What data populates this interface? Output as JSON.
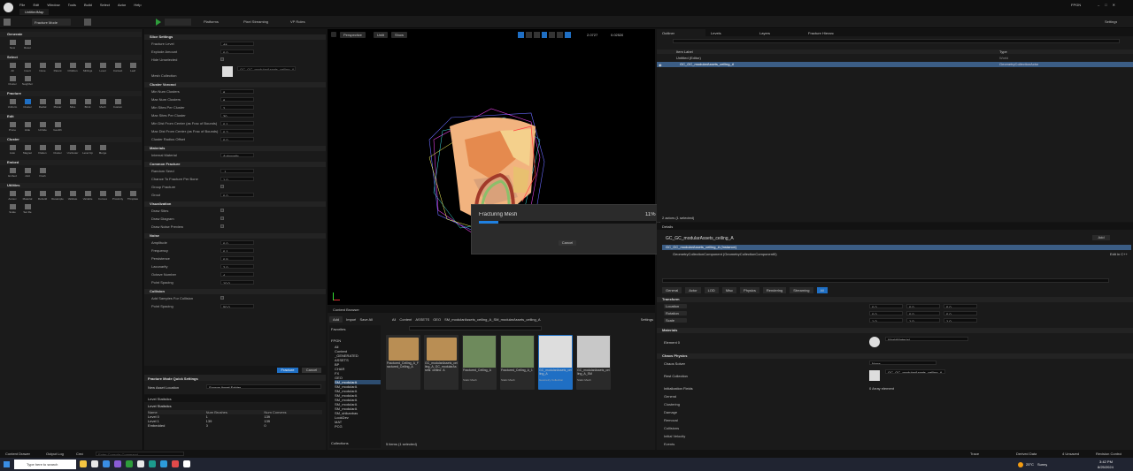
{
  "menu": [
    "File",
    "Edit",
    "Window",
    "Tools",
    "Build",
    "Select",
    "Actor",
    "Help"
  ],
  "project": "UntitledMap",
  "title_right": "FPGN",
  "mode": "Fracture Mode",
  "toolbar": {
    "platforms": "Platforms",
    "pixel": "Pixel Streaming",
    "vp": "VP Roles",
    "settings": "Settings"
  },
  "left_sections": [
    {
      "name": "Generate",
      "items": [
        "New",
        "Reset"
      ]
    },
    {
      "name": "Select",
      "items": [
        "All",
        "Invert",
        "None",
        "Parent",
        "Children",
        "Siblings",
        "Level",
        "Contact",
        "Leaf",
        "Cluster",
        "Neighbor"
      ]
    },
    {
      "name": "Fracture",
      "items": [
        "Uniform",
        "Cluster",
        "Radial",
        "Planar",
        "Slice",
        "Brick",
        "Mesh",
        "Custom"
      ]
    },
    {
      "name": "Edit",
      "items": [
        "Prune",
        "Hide",
        "Unhide",
        "Geolith"
      ]
    },
    {
      "name": "Cluster",
      "items": [
        "Auto",
        "Magnet",
        "Flatten",
        "Cluster",
        "Uncluster",
        "Level Up",
        "Merge"
      ]
    },
    {
      "name": "Embed",
      "items": [
        "Embed",
        "Add",
        "Flush"
      ]
    },
    {
      "name": "Utilities",
      "items": [
        "Autouv",
        "Material",
        "Rebuild",
        "Resample",
        "Validate",
        "Variable",
        "Convex",
        "Proximity",
        "Thinplate",
        "Scale",
        "Set Re"
      ]
    }
  ],
  "props": [
    {
      "section": "Slice Settings",
      "rows": [
        [
          "Fracture Level",
          "All"
        ],
        [
          "Explode Amount",
          "0.0"
        ],
        [
          "Hide Unselected",
          ""
        ],
        [
          "",
          ""
        ],
        [
          "Mesh Collection",
          "GC_GC_modularAssets_ceiling_A"
        ]
      ]
    },
    {
      "section": "Cluster Voronoi",
      "rows": [
        [
          "Min Num Clusters",
          "8"
        ],
        [
          "Max Num Clusters",
          "8"
        ],
        [
          "Min Sites Per Cluster",
          "2"
        ],
        [
          "Max Sites Per Cluster",
          "30"
        ],
        [
          "Min Dist From Center (as Frac of Bounds)",
          "0.1"
        ],
        [
          "Max Dist From Center (as Frac of Bounds)",
          "0.2"
        ],
        [
          "Cluster Radius Offset",
          "0.0"
        ]
      ]
    },
    {
      "section": "Materials",
      "rows": [
        [
          "Internal Material",
          "Automatic"
        ]
      ]
    },
    {
      "section": "Common Fracture",
      "rows": [
        [
          "Random Seed",
          "-1"
        ],
        [
          "Chance To Fracture Per Bone",
          "1.0"
        ],
        [
          "Group Fracture",
          ""
        ],
        [
          "Grout",
          "0.0"
        ]
      ]
    },
    {
      "section": "Visualization",
      "rows": [
        [
          "Draw Sites",
          ""
        ],
        [
          "Draw Diagram",
          ""
        ],
        [
          "Draw Noise Preview",
          ""
        ]
      ]
    },
    {
      "section": "Noise",
      "rows": [
        [
          "Amplitude",
          "0.0"
        ],
        [
          "Frequency",
          "0.1"
        ],
        [
          "Persistence",
          "0.5"
        ],
        [
          "Lacunarity",
          "2.0"
        ],
        [
          "Octave Number",
          "4"
        ],
        [
          "Point Spacing",
          "10.0"
        ]
      ]
    },
    {
      "section": "Collision",
      "rows": [
        [
          "Add Samples For Collision",
          ""
        ],
        [
          "Point Spacing",
          "50.0"
        ]
      ]
    }
  ],
  "fracture_btn": "Fracture",
  "cancel_btn": "Cancel",
  "quick": {
    "title": "Fracture Mode Quick Settings",
    "label": "New Asset Location",
    "value": "Source Asset Folder"
  },
  "levelstats": {
    "tab": "Level Statistics",
    "sub": "Level Statistics",
    "cols": [
      "Name",
      "Num Brushes",
      "Num Convexs"
    ],
    "rows": [
      [
        "Level 0",
        "1",
        "139"
      ],
      [
        "Level 1",
        "139",
        "139"
      ],
      [
        "Embedded",
        "0",
        "0"
      ]
    ]
  },
  "viewport": {
    "perspective": "Perspective",
    "lit": "Unlit",
    "show": "Show",
    "speed": "2.0727",
    "fov": "0.02526"
  },
  "progress": {
    "title": "Fracturing Mesh",
    "pct": "11%",
    "value": 0.11,
    "cancel": "Cancel"
  },
  "content": {
    "tab": "Content Browser",
    "add": "Add",
    "import": "Import",
    "saveall": "Save All",
    "path": [
      "All",
      "Content",
      "ASSETS",
      "GEO",
      "SM_modularAssets_ceiling_A_SM_modularAssets_ceiling_A"
    ],
    "settings": "Settings",
    "favorites": "Favorites",
    "root": "FPGN",
    "tree": [
      "All",
      "Content",
      "_GENERATED",
      "ASSETS",
      "BP",
      "CHAR",
      "FX",
      "GEO",
      "SM_modularA",
      "SM_modularA",
      "SM_modularA",
      "SM_modularA",
      "SM_modularA",
      "SM_modularA",
      "SM_modularA",
      "SM_shikanbas",
      "LookDev",
      "MAT",
      "PCG"
    ],
    "collections": "Collections",
    "count": "5 items (1 selected)",
    "assets": [
      {
        "name": "Fractured_Ceiling_A_Fractured_Ceiling_A",
        "type": "",
        "kind": "folder"
      },
      {
        "name": "GC_modularAssets_ceiling_A_GC_modularAssets_ceiling_A",
        "type": "",
        "kind": "folder"
      },
      {
        "name": "Fractured_Ceiling_A",
        "type": "Static Mesh",
        "kind": "mesh"
      },
      {
        "name": "Fractured_Ceiling_A_1",
        "type": "Static Mesh",
        "kind": "mesh"
      },
      {
        "name": "GC_modularAssets_ceiling_A",
        "type": "Geometry Collection",
        "kind": "sel"
      },
      {
        "name": "GC_modularAssets_ceiling_A_SM",
        "type": "Static Mesh",
        "kind": "mesh2"
      }
    ]
  },
  "outliner": {
    "tabs": [
      "Outliner",
      "Levels",
      "Layers",
      "Fracture Hierarc"
    ],
    "col1": "Item Label",
    "col2": "Type",
    "rows": [
      [
        "Untitled (Editor)",
        "World"
      ],
      [
        "GC_GC_modularAssets_ceiling_A",
        "GeometryCollectionActor"
      ]
    ],
    "actors": "2 actors (1 selected)"
  },
  "details": {
    "tab": "Details",
    "actor": "GC_GC_modularAssets_ceiling_A",
    "add": "Add",
    "instance": "GC_GC_modularAssets_ceiling_A (Instance)",
    "component": "GeometryCollectionComponent (GeometryCollectionComponent0)",
    "editin": "Edit in C++",
    "filters": [
      "General",
      "Actor",
      "LOD",
      "Misc",
      "Physics",
      "Rendering",
      "Streaming",
      "All"
    ],
    "transform": "Transform",
    "location": "Location",
    "rotation": "Rotation",
    "scale": "Scale",
    "loc": [
      "0.0",
      "0.0",
      "0.0"
    ],
    "rot": [
      "0.0",
      "0.0",
      "0.0"
    ],
    "scl": [
      "1.0",
      "1.0",
      "1.0"
    ],
    "materials": "Materials",
    "element": "Element 0",
    "wm": "WorldMaterial",
    "chaos": "Chaos Physics",
    "solver": "Chaos Solver",
    "none": "None",
    "restcol": "Rest Collection",
    "restval": "GC_GC_modularAssets_ceiling_A",
    "initvel": "Initialization Fields",
    "elements": "0 Array element",
    "cats": [
      "General",
      "Clustering",
      "Damage",
      "Removal",
      "Collisions",
      "Initial Velocity",
      "Events"
    ]
  },
  "status": {
    "drawer": "Content Drawer",
    "output": "Output Log",
    "cmd": "Cmd",
    "cmdph": "Enter Console Command",
    "derived": "Derived Data",
    "unsaved": "4 Unsaved",
    "revision": "Revision Control",
    "trace": "Trace"
  },
  "taskbar": {
    "search": "Type here to search",
    "weather": "25°C",
    "cond": "Sunny",
    "time": "3:42 PM",
    "date": "8/25/2024"
  }
}
